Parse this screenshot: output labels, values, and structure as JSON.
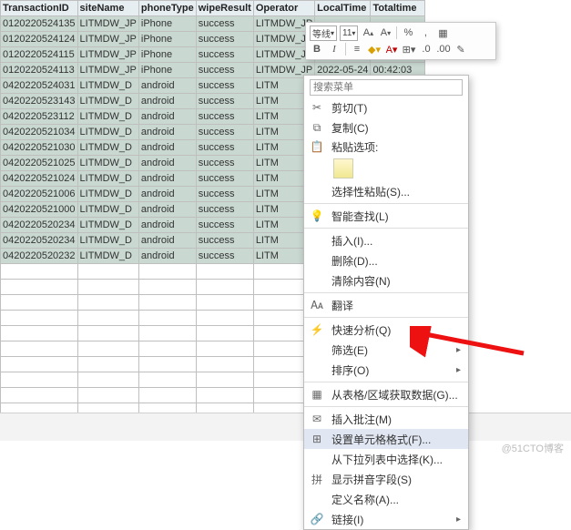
{
  "table": {
    "headers": [
      "TransactionID",
      "siteName",
      "phoneType",
      "wipeResult",
      "Operator",
      "LocalTime",
      "Totaltime"
    ],
    "rows": [
      [
        "0120220524135",
        "LITMDW_JP",
        "iPhone",
        "success",
        "LITMDW_JP",
        "",
        ""
      ],
      [
        "0120220524124",
        "LITMDW_JP",
        "iPhone",
        "success",
        "LITMDW_JP",
        "",
        ""
      ],
      [
        "0120220524115",
        "LITMDW_JP",
        "iPhone",
        "success",
        "LITMDW_JP",
        "",
        ""
      ],
      [
        "0120220524113",
        "LITMDW_JP",
        "iPhone",
        "success",
        "LITMDW_JP",
        "2022-05-24",
        "00:42:03"
      ],
      [
        "0420220524031",
        "LITMDW_D",
        "android",
        "success",
        "LITM",
        "",
        ""
      ],
      [
        "0420220523143",
        "LITMDW_D",
        "android",
        "success",
        "LITM",
        "",
        ""
      ],
      [
        "0420220523112",
        "LITMDW_D",
        "android",
        "success",
        "LITM",
        "",
        ""
      ],
      [
        "0420220521034",
        "LITMDW_D",
        "android",
        "success",
        "LITM",
        "",
        ""
      ],
      [
        "0420220521030",
        "LITMDW_D",
        "android",
        "success",
        "LITM",
        "",
        ""
      ],
      [
        "0420220521025",
        "LITMDW_D",
        "android",
        "success",
        "LITM",
        "",
        ""
      ],
      [
        "0420220521024",
        "LITMDW_D",
        "android",
        "success",
        "LITM",
        "",
        ""
      ],
      [
        "0420220521006",
        "LITMDW_D",
        "android",
        "success",
        "LITM",
        "",
        ""
      ],
      [
        "0420220521000",
        "LITMDW_D",
        "android",
        "success",
        "LITM",
        "",
        ""
      ],
      [
        "0420220520234",
        "LITMDW_D",
        "android",
        "success",
        "LITM",
        "",
        ""
      ],
      [
        "0420220520234",
        "LITMDW_D",
        "android",
        "success",
        "LITM",
        "",
        ""
      ],
      [
        "0420220520232",
        "LITMDW_D",
        "android",
        "success",
        "LITM",
        "",
        ""
      ]
    ]
  },
  "toolbar": {
    "font_name": "等线",
    "font_size": "11",
    "bold": "B",
    "italic": "I"
  },
  "menu": {
    "search_placeholder": "搜索菜单",
    "cut": "剪切(T)",
    "copy": "复制(C)",
    "paste_section": "粘贴选项:",
    "paste_special": "选择性粘贴(S)...",
    "smart_lookup": "智能查找(L)",
    "insert": "插入(I)...",
    "delete": "删除(D)...",
    "clear": "清除内容(N)",
    "translate": "翻译",
    "quick_analysis": "快速分析(Q)",
    "filter": "筛选(E)",
    "sort": "排序(O)",
    "get_data": "从表格/区域获取数据(G)...",
    "insert_comment": "插入批注(M)",
    "format_cells": "设置单元格格式(F)...",
    "pick_from_list": "从下拉列表中选择(K)...",
    "show_pinyin": "显示拼音字段(S)",
    "define_name": "定义名称(A)...",
    "hyperlink": "链接(I)"
  },
  "watermark": "@51CTO博客"
}
